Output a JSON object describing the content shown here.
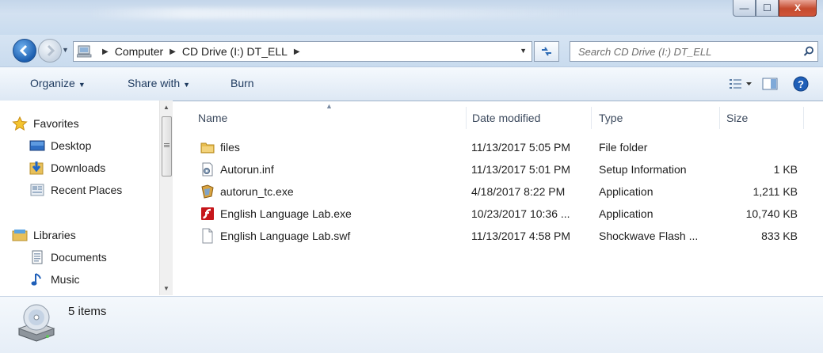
{
  "window": {
    "minimize_glyph": "—",
    "maximize_glyph": "☐",
    "close_glyph": "X"
  },
  "address": {
    "crumbs": [
      "Computer",
      "CD Drive (I:) DT_ELL"
    ],
    "search_placeholder": "Search CD Drive (I:) DT_ELL"
  },
  "toolbar": {
    "organize": "Organize",
    "share_with": "Share with",
    "burn": "Burn"
  },
  "sidebar": {
    "favorites": "Favorites",
    "desktop": "Desktop",
    "downloads": "Downloads",
    "recent_places": "Recent Places",
    "libraries": "Libraries",
    "documents": "Documents",
    "music": "Music"
  },
  "columns": {
    "name": "Name",
    "date_modified": "Date modified",
    "type": "Type",
    "size": "Size"
  },
  "files": [
    {
      "name": "files",
      "date": "11/13/2017 5:05 PM",
      "type": "File folder",
      "size": "",
      "icon": "folder-icon"
    },
    {
      "name": "Autorun.inf",
      "date": "11/13/2017 5:01 PM",
      "type": "Setup Information",
      "size": "1 KB",
      "icon": "setup-file-icon"
    },
    {
      "name": "autorun_tc.exe",
      "date": "4/18/2017 8:22 PM",
      "type": "Application",
      "size": "1,211 KB",
      "icon": "application-icon"
    },
    {
      "name": "English Language Lab.exe",
      "date": "10/23/2017 10:36 ...",
      "type": "Application",
      "size": "10,740 KB",
      "icon": "flash-app-icon"
    },
    {
      "name": "English Language Lab.swf",
      "date": "11/13/2017 4:58 PM",
      "type": "Shockwave Flash ...",
      "size": "833 KB",
      "icon": "blank-file-icon"
    }
  ],
  "status": {
    "item_count": "5 items"
  }
}
